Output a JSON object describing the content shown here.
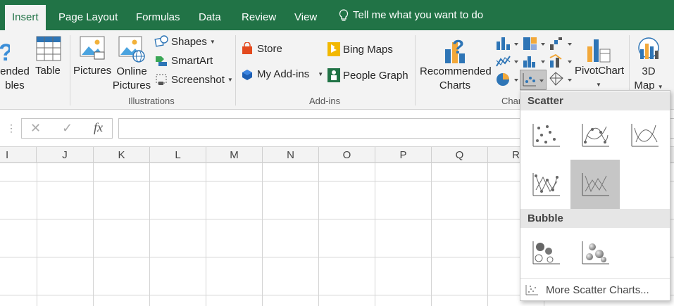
{
  "tabs": {
    "insert": "Insert",
    "page_layout": "Page Layout",
    "formulas": "Formulas",
    "data": "Data",
    "review": "Review",
    "view": "View",
    "tell_me": "Tell me what you want to do"
  },
  "ribbon": {
    "tables": {
      "recommended_pivot_line1": "ended",
      "recommended_pivot_line2": "bles",
      "table": "Table"
    },
    "illustrations": {
      "pictures": "Pictures",
      "online_line1": "Online",
      "online_line2": "Pictures",
      "shapes": "Shapes",
      "smartart": "SmartArt",
      "screenshot": "Screenshot",
      "group_label": "Illustrations"
    },
    "addins": {
      "store": "Store",
      "my_addins": "My Add-ins",
      "bing_maps": "Bing Maps",
      "people_graph": "People Graph",
      "group_label": "Add-ins"
    },
    "charts": {
      "recommended_line1": "Recommended",
      "recommended_line2": "Charts",
      "pivotchart": "PivotChart",
      "map_line1": "3D",
      "map_line2": "Map",
      "group_label": "Char"
    }
  },
  "formula_bar": {
    "cancel": "✕",
    "enter": "✓",
    "fx": "fx"
  },
  "columns": [
    "I",
    "J",
    "K",
    "L",
    "M",
    "N",
    "O",
    "P",
    "Q",
    "R"
  ],
  "dropdown": {
    "scatter_header": "Scatter",
    "bubble_header": "Bubble",
    "more": "More Scatter Charts..."
  },
  "colors": {
    "accent": "#217346",
    "selected": "#c6c6c6"
  }
}
